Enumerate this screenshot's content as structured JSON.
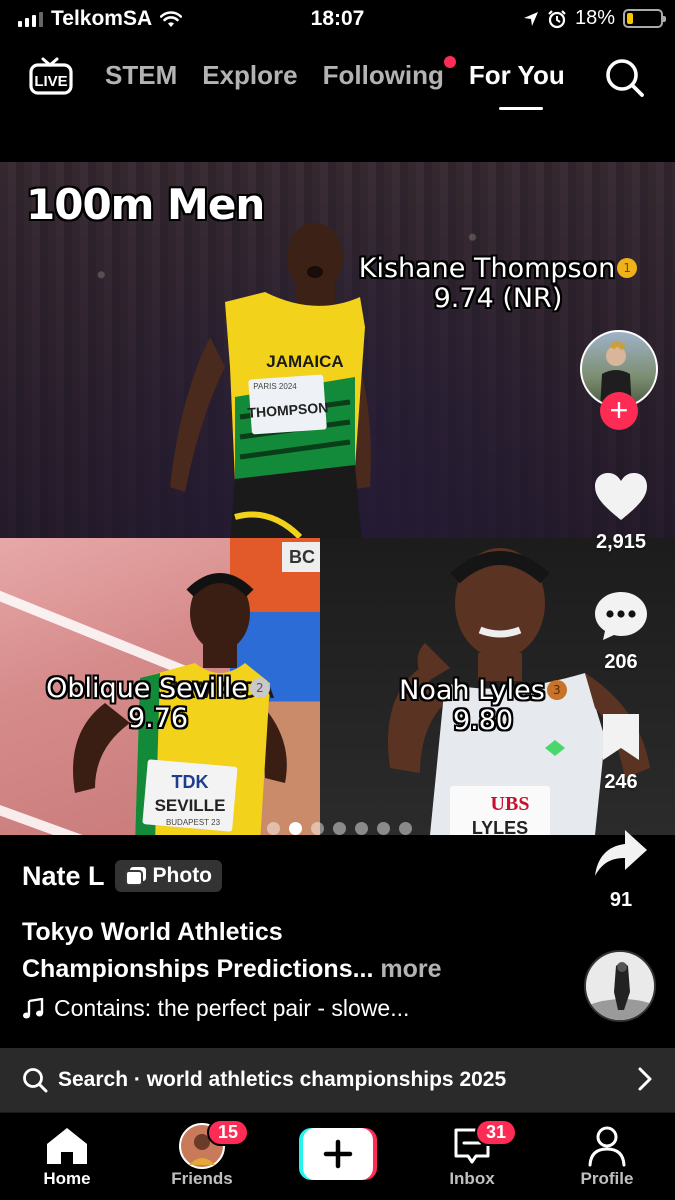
{
  "status_bar": {
    "carrier": "TelkomSA",
    "time": "18:07",
    "battery_percent": "18%",
    "battery_level": 0.18
  },
  "top_nav": {
    "live_label": "LIVE",
    "tabs": [
      {
        "label": "STEM",
        "active": false
      },
      {
        "label": "Explore",
        "active": false
      },
      {
        "label": "Following",
        "active": false,
        "has_dot": true
      },
      {
        "label": "For You",
        "active": true
      }
    ]
  },
  "post": {
    "overlay": {
      "heading": "100m Men",
      "gold_name": "Kishane Thompson",
      "gold_time": "9.74 (NR)",
      "gold_medal": "1",
      "silver_name": "Oblique Seville",
      "silver_time": "9.76",
      "silver_medal": "2",
      "bronze_name": "Noah Lyles",
      "bronze_time": "9.80",
      "bronze_medal": "3"
    },
    "photo_text": {
      "jersey_country": "JAMAICA",
      "bib_thompson_top": "PARIS 2024",
      "bib_thompson": "THOMPSON",
      "bib_seville_brand": "TDK",
      "bib_seville": "SEVILLE",
      "bib_seville_bottom": "BUDAPEST 23",
      "bib_lyles_brand": "UBS",
      "bib_lyles": "LYLES",
      "bib_partial": "BC"
    },
    "carousel": {
      "count": 7,
      "current": 2
    },
    "author": "Nate L",
    "type_badge": "Photo",
    "caption_line1": "Tokyo World Athletics",
    "caption_line2": "Championships Predictions...",
    "more_label": "more",
    "music": "Contains: the perfect pair - slowe..."
  },
  "rail": {
    "likes": "2,915",
    "comments": "206",
    "saves": "246",
    "shares": "91"
  },
  "search_suggestion": {
    "prefix": "Search",
    "separator": " · ",
    "query": "world athletics championships 2025"
  },
  "bottom_nav": {
    "home": "Home",
    "friends": "Friends",
    "friends_badge": "15",
    "inbox": "Inbox",
    "inbox_badge": "31",
    "profile": "Profile"
  },
  "colors": {
    "accent": "#fe2c55",
    "battery": "#f7c600",
    "create_cyan": "#25f4ee"
  }
}
